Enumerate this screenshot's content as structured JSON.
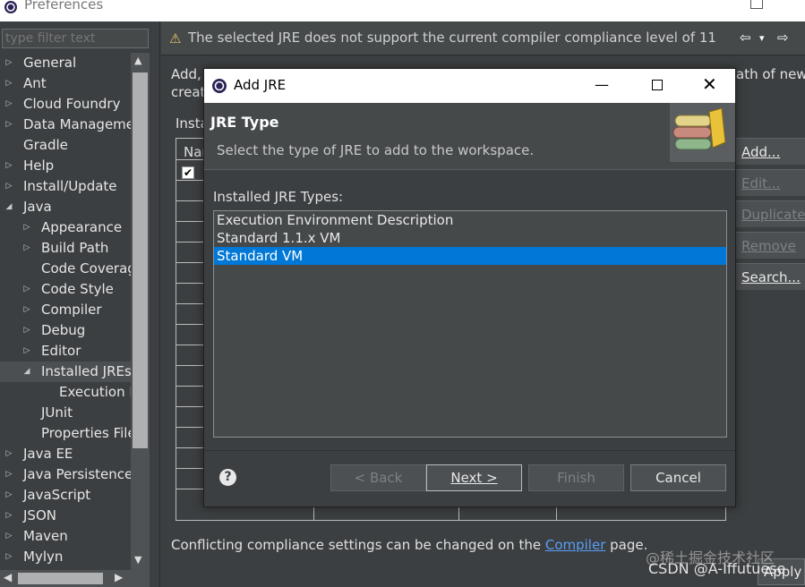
{
  "window": {
    "title": "Preferences",
    "filter_placeholder": "type filter text"
  },
  "tree": {
    "items": [
      {
        "label": "General",
        "level": 0,
        "arrow": "▷"
      },
      {
        "label": "Ant",
        "level": 0,
        "arrow": "▷"
      },
      {
        "label": "Cloud Foundry",
        "level": 0,
        "arrow": "▷"
      },
      {
        "label": "Data Management",
        "level": 0,
        "arrow": "▷"
      },
      {
        "label": "Gradle",
        "level": 0,
        "arrow": ""
      },
      {
        "label": "Help",
        "level": 0,
        "arrow": "▷"
      },
      {
        "label": "Install/Update",
        "level": 0,
        "arrow": "▷"
      },
      {
        "label": "Java",
        "level": 0,
        "arrow": "◢"
      },
      {
        "label": "Appearance",
        "level": 1,
        "arrow": "▷"
      },
      {
        "label": "Build Path",
        "level": 1,
        "arrow": "▷"
      },
      {
        "label": "Code Coverage",
        "level": 1,
        "arrow": ""
      },
      {
        "label": "Code Style",
        "level": 1,
        "arrow": "▷"
      },
      {
        "label": "Compiler",
        "level": 1,
        "arrow": "▷"
      },
      {
        "label": "Debug",
        "level": 1,
        "arrow": "▷"
      },
      {
        "label": "Editor",
        "level": 1,
        "arrow": "▷"
      },
      {
        "label": "Installed JREs",
        "level": 1,
        "arrow": "◢",
        "selected": true
      },
      {
        "label": "Execution Environments",
        "level": 2,
        "arrow": ""
      },
      {
        "label": "JUnit",
        "level": 1,
        "arrow": ""
      },
      {
        "label": "Properties Files Editor",
        "level": 1,
        "arrow": ""
      },
      {
        "label": "Java EE",
        "level": 0,
        "arrow": "▷"
      },
      {
        "label": "Java Persistence",
        "level": 0,
        "arrow": "▷"
      },
      {
        "label": "JavaScript",
        "level": 0,
        "arrow": "▷"
      },
      {
        "label": "JSON",
        "level": 0,
        "arrow": "▷"
      },
      {
        "label": "Maven",
        "level": 0,
        "arrow": "▷"
      },
      {
        "label": "Mylyn",
        "level": 0,
        "arrow": "▷"
      }
    ]
  },
  "warning": {
    "icon": "warning-icon",
    "text": "The selected JRE does not support the current compiler compliance level of 11",
    "back_glyph": "⇦",
    "menu_glyph": "▾",
    "forward_glyph": "⇨"
  },
  "background_page": {
    "desc_line1": "Add,",
    "desc_line1_tail": "ath of new",
    "desc_line2": "creat",
    "installed_label": "Insta",
    "table_header": "Nar",
    "footer_text": "Conflicting compliance settings can be changed on the ",
    "footer_link": "Compiler",
    "footer_tail": " page.",
    "apply_label": "Apply"
  },
  "side_buttons": [
    {
      "label": "Add...",
      "enabled": true
    },
    {
      "label": "Edit...",
      "enabled": false
    },
    {
      "label": "Duplicate...",
      "enabled": false
    },
    {
      "label": "Remove",
      "enabled": false
    },
    {
      "label": "Search...",
      "enabled": true
    }
  ],
  "dialog": {
    "title": "Add JRE",
    "header_title": "JRE Type",
    "header_desc": "Select the type of JRE to add to the workspace.",
    "list_label": "Installed JRE Types:",
    "jre_types": [
      {
        "label": "Execution Environment Description",
        "selected": false
      },
      {
        "label": "Standard 1.1.x VM",
        "selected": false
      },
      {
        "label": "Standard VM",
        "selected": true
      }
    ],
    "help_glyph": "?",
    "buttons": {
      "back": "< Back",
      "next": "Next >",
      "finish": "Finish",
      "cancel": "Cancel"
    },
    "controls": {
      "minimize": "—",
      "close": "✕"
    }
  },
  "watermark": {
    "line1": "@稀土掘金技术社区",
    "line2": "CSDN @A-Iffutuese"
  }
}
